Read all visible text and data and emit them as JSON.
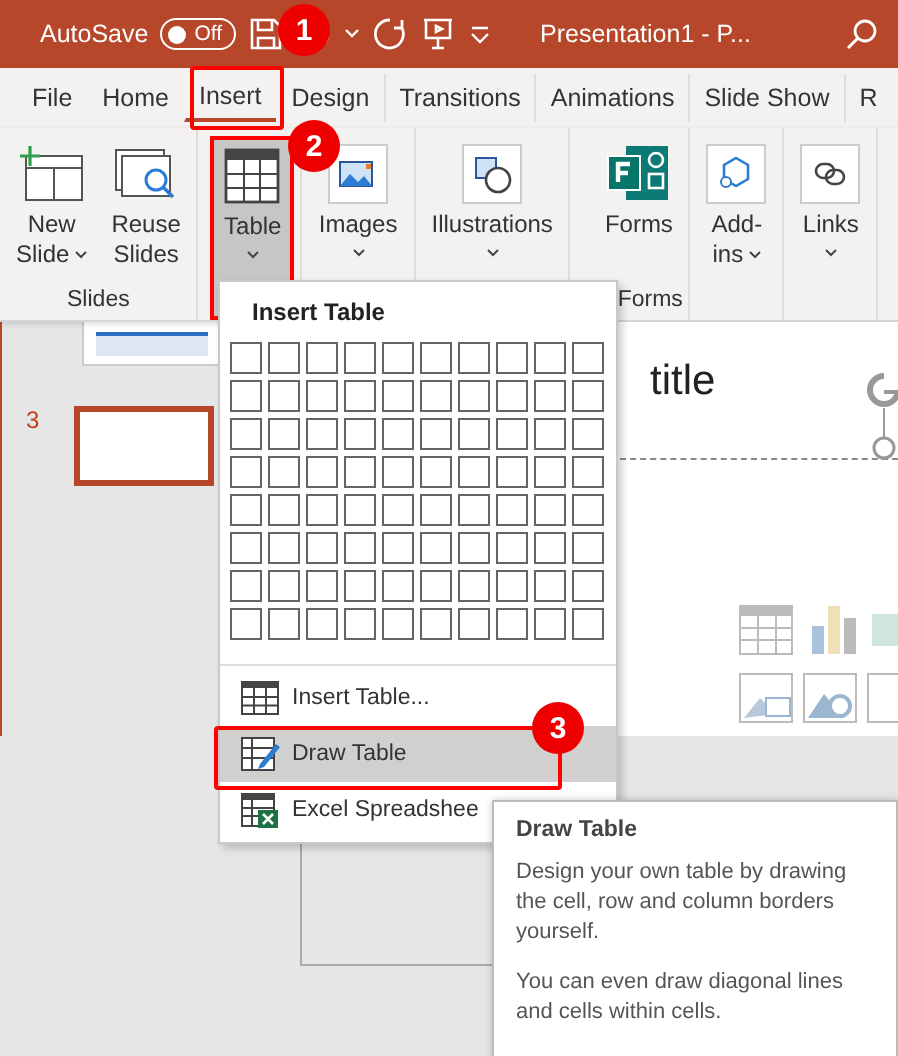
{
  "title_bar": {
    "autosave_label": "AutoSave",
    "autosave_toggle": {
      "label": "Off",
      "on": false
    },
    "document_title": "Presentation1  -  P..."
  },
  "tabs": [
    {
      "label": "File",
      "selected": false
    },
    {
      "label": "Home",
      "selected": false
    },
    {
      "label": "Insert",
      "selected": true
    },
    {
      "label": "Design",
      "selected": false
    },
    {
      "label": "Transitions",
      "selected": false
    },
    {
      "label": "Animations",
      "selected": false
    },
    {
      "label": "Slide Show",
      "selected": false
    },
    {
      "label": "R",
      "selected": false
    }
  ],
  "ribbon": {
    "groups": [
      {
        "label": "Slides",
        "buttons": [
          {
            "kind": "new-slide",
            "lines": [
              "New",
              "Slide"
            ],
            "dropdown": true,
            "pressed": false
          },
          {
            "kind": "reuse",
            "lines": [
              "Reuse",
              "Slides"
            ],
            "dropdown": false,
            "pressed": false
          }
        ]
      },
      {
        "buttons": [
          {
            "kind": "table",
            "lines": [
              "Table"
            ],
            "dropdown": true,
            "pressed": true
          }
        ]
      },
      {
        "buttons": [
          {
            "kind": "images",
            "lines": [
              "Images"
            ],
            "dropdown": true,
            "pressed": false
          }
        ]
      },
      {
        "buttons": [
          {
            "kind": "illustrations",
            "lines": [
              "Illustrations"
            ],
            "dropdown": true,
            "pressed": false
          }
        ]
      },
      {
        "label": "Forms",
        "buttons": [
          {
            "kind": "forms",
            "lines": [
              "Forms"
            ],
            "dropdown": false,
            "pressed": false
          }
        ]
      },
      {
        "buttons": [
          {
            "kind": "addins",
            "lines": [
              "Add-",
              "ins"
            ],
            "dropdown": true,
            "pressed": false
          }
        ]
      },
      {
        "buttons": [
          {
            "kind": "links",
            "lines": [
              "Links"
            ],
            "dropdown": true,
            "pressed": false
          }
        ]
      }
    ]
  },
  "slides": [
    {
      "selected": false
    },
    {
      "number": "3",
      "selected": true
    }
  ],
  "slide": {
    "title_placeholder": "title"
  },
  "dropdown": {
    "header": "Insert Table",
    "items": [
      {
        "kind": "insert-table",
        "label": "Insert Table...",
        "selected": false
      },
      {
        "kind": "draw-table",
        "label": "Draw Table",
        "selected": true
      },
      {
        "kind": "excel",
        "label": "Excel Spreadshee",
        "selected": false
      }
    ]
  },
  "tooltip": {
    "title": "Draw Table",
    "paragraphs": [
      "Design your own table by drawing the cell, row and column borders yourself.",
      "You can even draw diagonal lines and cells within cells."
    ]
  },
  "callouts": [
    {
      "label": "1"
    },
    {
      "label": "2"
    },
    {
      "label": "3"
    }
  ]
}
